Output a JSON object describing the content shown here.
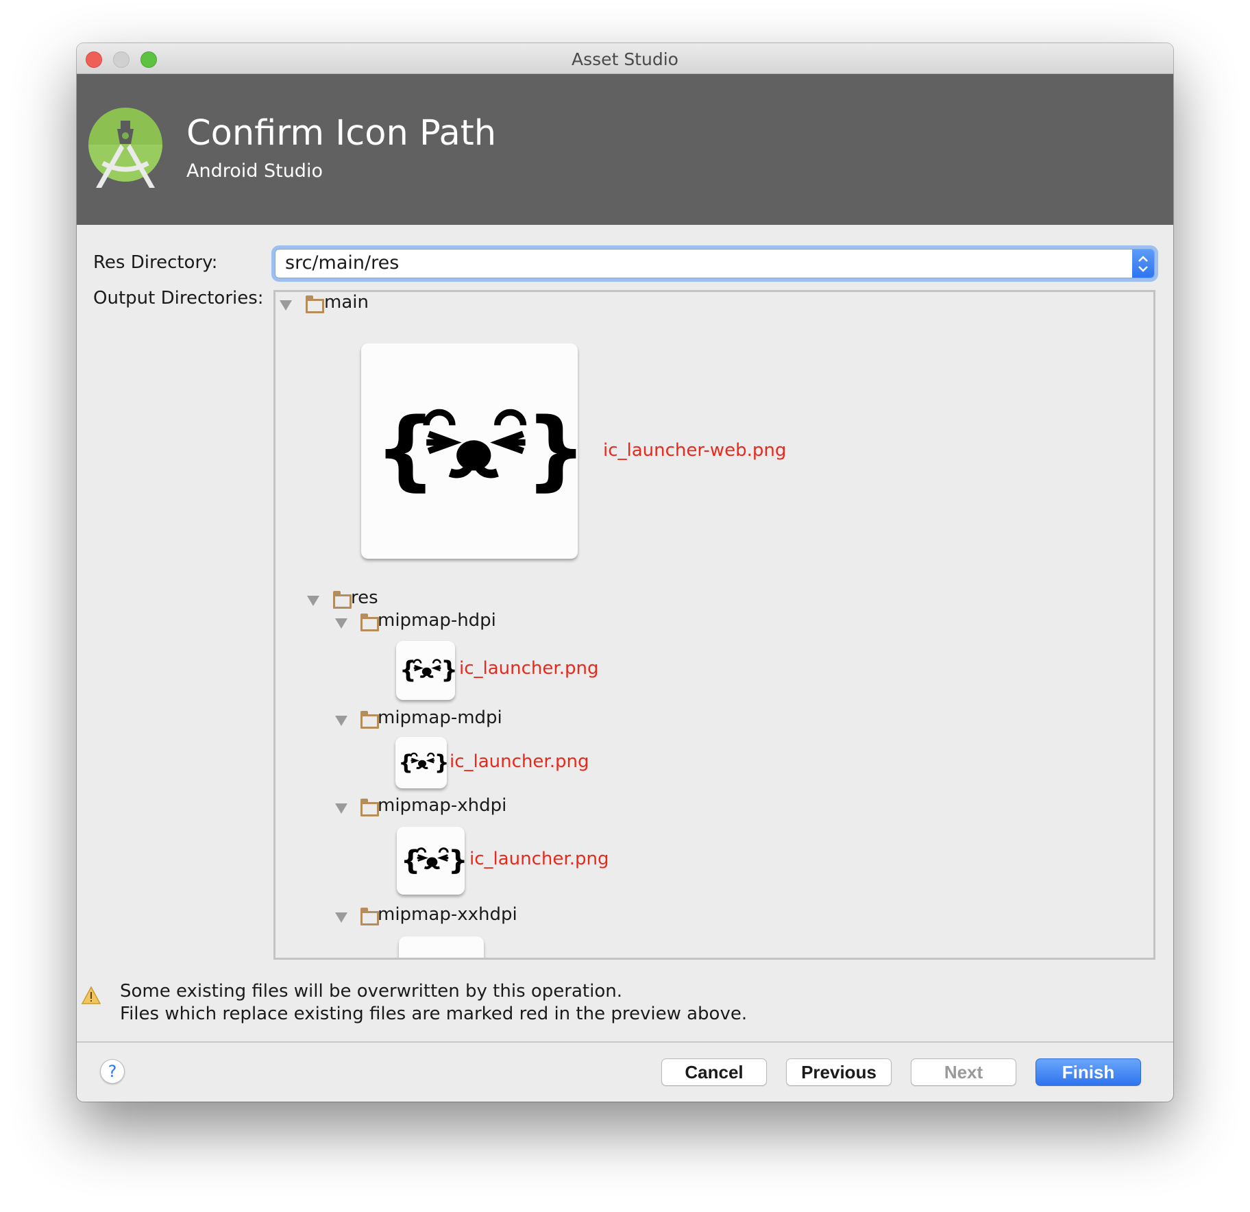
{
  "window": {
    "title": "Asset Studio"
  },
  "header": {
    "title": "Confirm Icon Path",
    "subtitle": "Android Studio",
    "logo": "android-studio-logo"
  },
  "form": {
    "res_directory_label": "Res Directory:",
    "res_directory_value": "src/main/res",
    "output_directories_label": "Output Directories:"
  },
  "tree": {
    "main": "main",
    "web_icon": "ic_launcher-web.png",
    "res": "res",
    "folders": [
      {
        "name": "mipmap-hdpi",
        "file": "ic_launcher.png"
      },
      {
        "name": "mipmap-mdpi",
        "file": "ic_launcher.png"
      },
      {
        "name": "mipmap-xhdpi",
        "file": "ic_launcher.png"
      },
      {
        "name": "mipmap-xxhdpi",
        "file": ""
      }
    ]
  },
  "warning": {
    "line1": "Some existing files will be overwritten by this operation.",
    "line2": "Files which replace existing files are marked red in the preview above."
  },
  "buttons": {
    "help": "?",
    "cancel": "Cancel",
    "previous": "Previous",
    "next": "Next",
    "finish": "Finish"
  },
  "colors": {
    "overwrite": "#e8291c",
    "accent": "#2f74f0",
    "header": "#616161"
  }
}
